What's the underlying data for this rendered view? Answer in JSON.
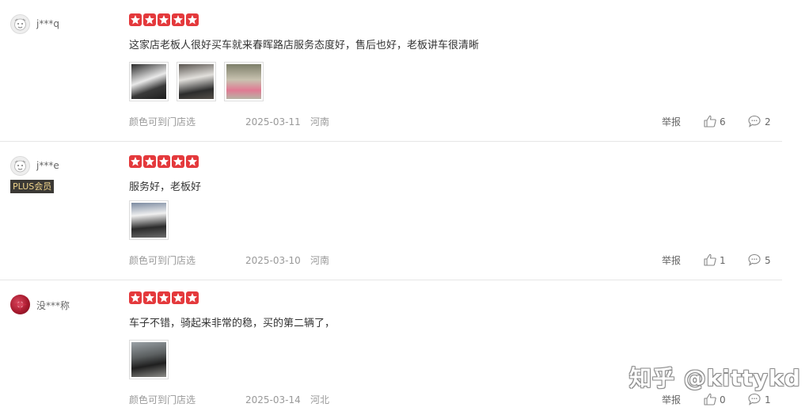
{
  "reviews": [
    {
      "user": "j***q",
      "plus": "",
      "text": "这家店老板人很好买车就来春晖路店服务态度好，售后也好，老板讲车很清晰",
      "color_option": "颜色可到门店选",
      "date": "2025-03-11",
      "location": "河南",
      "report_label": "举报",
      "likes": "6",
      "comments": "2",
      "rating": 5
    },
    {
      "user": "j***e",
      "plus": "PLUS会员",
      "text": "服务好，老板好",
      "color_option": "颜色可到门店选",
      "date": "2025-03-10",
      "location": "河南",
      "report_label": "举报",
      "likes": "1",
      "comments": "5",
      "rating": 5
    },
    {
      "user": "没***称",
      "plus": "",
      "text": "车子不错，骑起来非常的稳，买的第二辆了，",
      "color_option": "颜色可到门店选",
      "date": "2025-03-14",
      "location": "河北",
      "report_label": "举报",
      "likes": "0",
      "comments": "1",
      "rating": 5
    }
  ],
  "watermark": "知乎 @kittykd",
  "colors": {
    "star": "#e4393c",
    "plus_bg": "#3b3935",
    "plus_text": "#f0d58c"
  },
  "icons": [
    "default-avatar-icon",
    "star-icon",
    "thumb-up-icon",
    "comment-icon"
  ]
}
